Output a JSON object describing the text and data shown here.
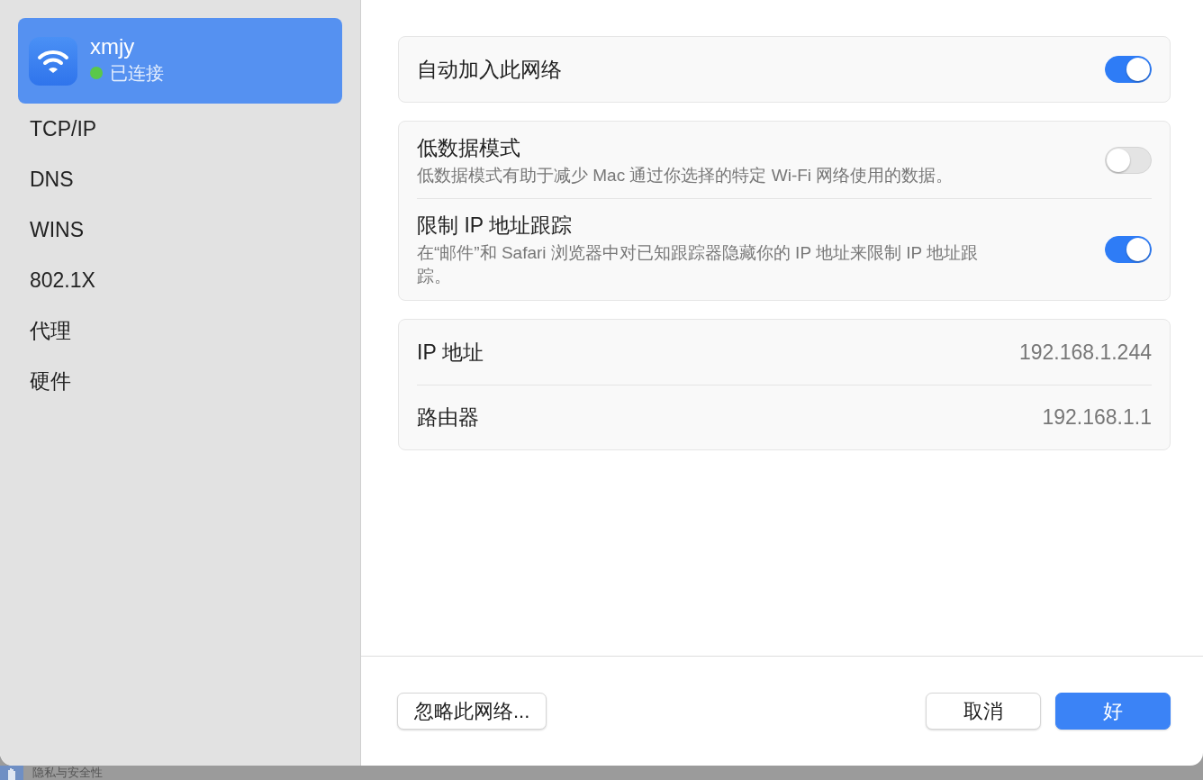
{
  "sidebar": {
    "network": {
      "name": "xmjy",
      "status": "已连接",
      "color": "#5ac84a",
      "selected": true
    },
    "items": [
      {
        "label": "TCP/IP",
        "selected": false
      },
      {
        "label": "DNS",
        "selected": false
      },
      {
        "label": "WINS",
        "selected": false
      },
      {
        "label": "802.1X",
        "selected": false
      },
      {
        "label": "代理",
        "selected": false
      },
      {
        "label": "硬件",
        "selected": false
      }
    ]
  },
  "groups": [
    {
      "rows": [
        {
          "kind": "toggle",
          "label": "自动加入此网络",
          "on": true
        }
      ]
    },
    {
      "rows": [
        {
          "kind": "toggle",
          "label": "低数据模式",
          "description": "低数据模式有助于减少 Mac 通过你选择的特定 Wi-Fi 网络使用的数据。",
          "on": false
        },
        {
          "kind": "toggle",
          "label": "限制 IP 地址跟踪",
          "description": "在“邮件”和 Safari 浏览器中对已知跟踪器隐藏你的 IP 地址来限制 IP 地址跟踪。",
          "on": true
        }
      ]
    },
    {
      "rows": [
        {
          "kind": "info",
          "label": "IP 地址",
          "value": "192.168.1.244"
        },
        {
          "kind": "info",
          "label": "路由器",
          "value": "192.168.1.1"
        }
      ]
    }
  ],
  "footer": {
    "forget_button": "忽略此网络...",
    "cancel_button": "取消",
    "ok_button": "好"
  },
  "background_window": {
    "item_label": "隐私与安全性"
  }
}
